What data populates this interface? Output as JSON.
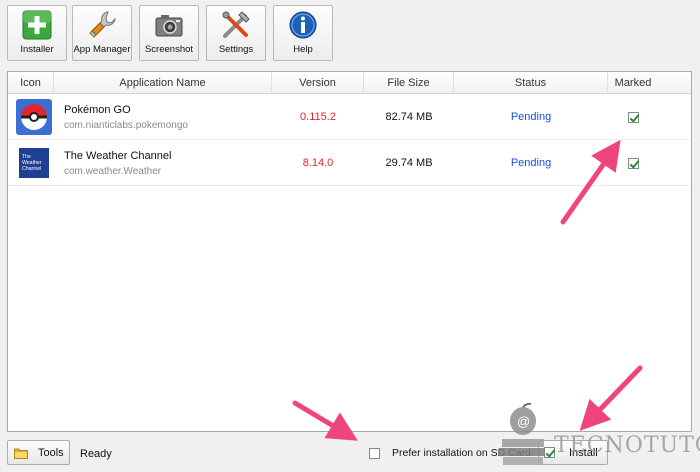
{
  "toolbar": {
    "buttons": [
      {
        "label": "Installer",
        "icon": "plus-icon"
      },
      {
        "label": "App Manager",
        "icon": "wrench-icon"
      },
      {
        "label": "Screenshot",
        "icon": "camera-icon"
      },
      {
        "label": "Settings",
        "icon": "tools-icon"
      },
      {
        "label": "Help",
        "icon": "info-icon"
      }
    ]
  },
  "table": {
    "columns": [
      "Icon",
      "Application Name",
      "Version",
      "File Size",
      "Status",
      "Marked"
    ],
    "rows": [
      {
        "name": "Pokémon GO",
        "package": "com.nianticlabs.pokemongo",
        "version": "0.115.2",
        "size": "82.74 MB",
        "status": "Pending",
        "marked": true,
        "icon": "pokeball-icon"
      },
      {
        "name": "The Weather Channel",
        "package": "com.weather.Weather",
        "version": "8.14.0",
        "size": "29.74 MB",
        "status": "Pending",
        "marked": true,
        "icon": "weather-channel-icon",
        "icon_text": "The Weather Channel"
      }
    ]
  },
  "bottombar": {
    "tools_label": "Tools",
    "status_text": "Ready",
    "sd_label": "Prefer installation on SD Card",
    "sd_checked": false,
    "install_label": "Install",
    "install_checked": true
  },
  "watermark": {
    "text": "TECNOTUTO"
  },
  "colors": {
    "version": "#d9262b",
    "status": "#1a4fd6",
    "arrow": "#f0457a",
    "plus_green": "#3aa83a",
    "help_blue": "#1e5fb8"
  }
}
